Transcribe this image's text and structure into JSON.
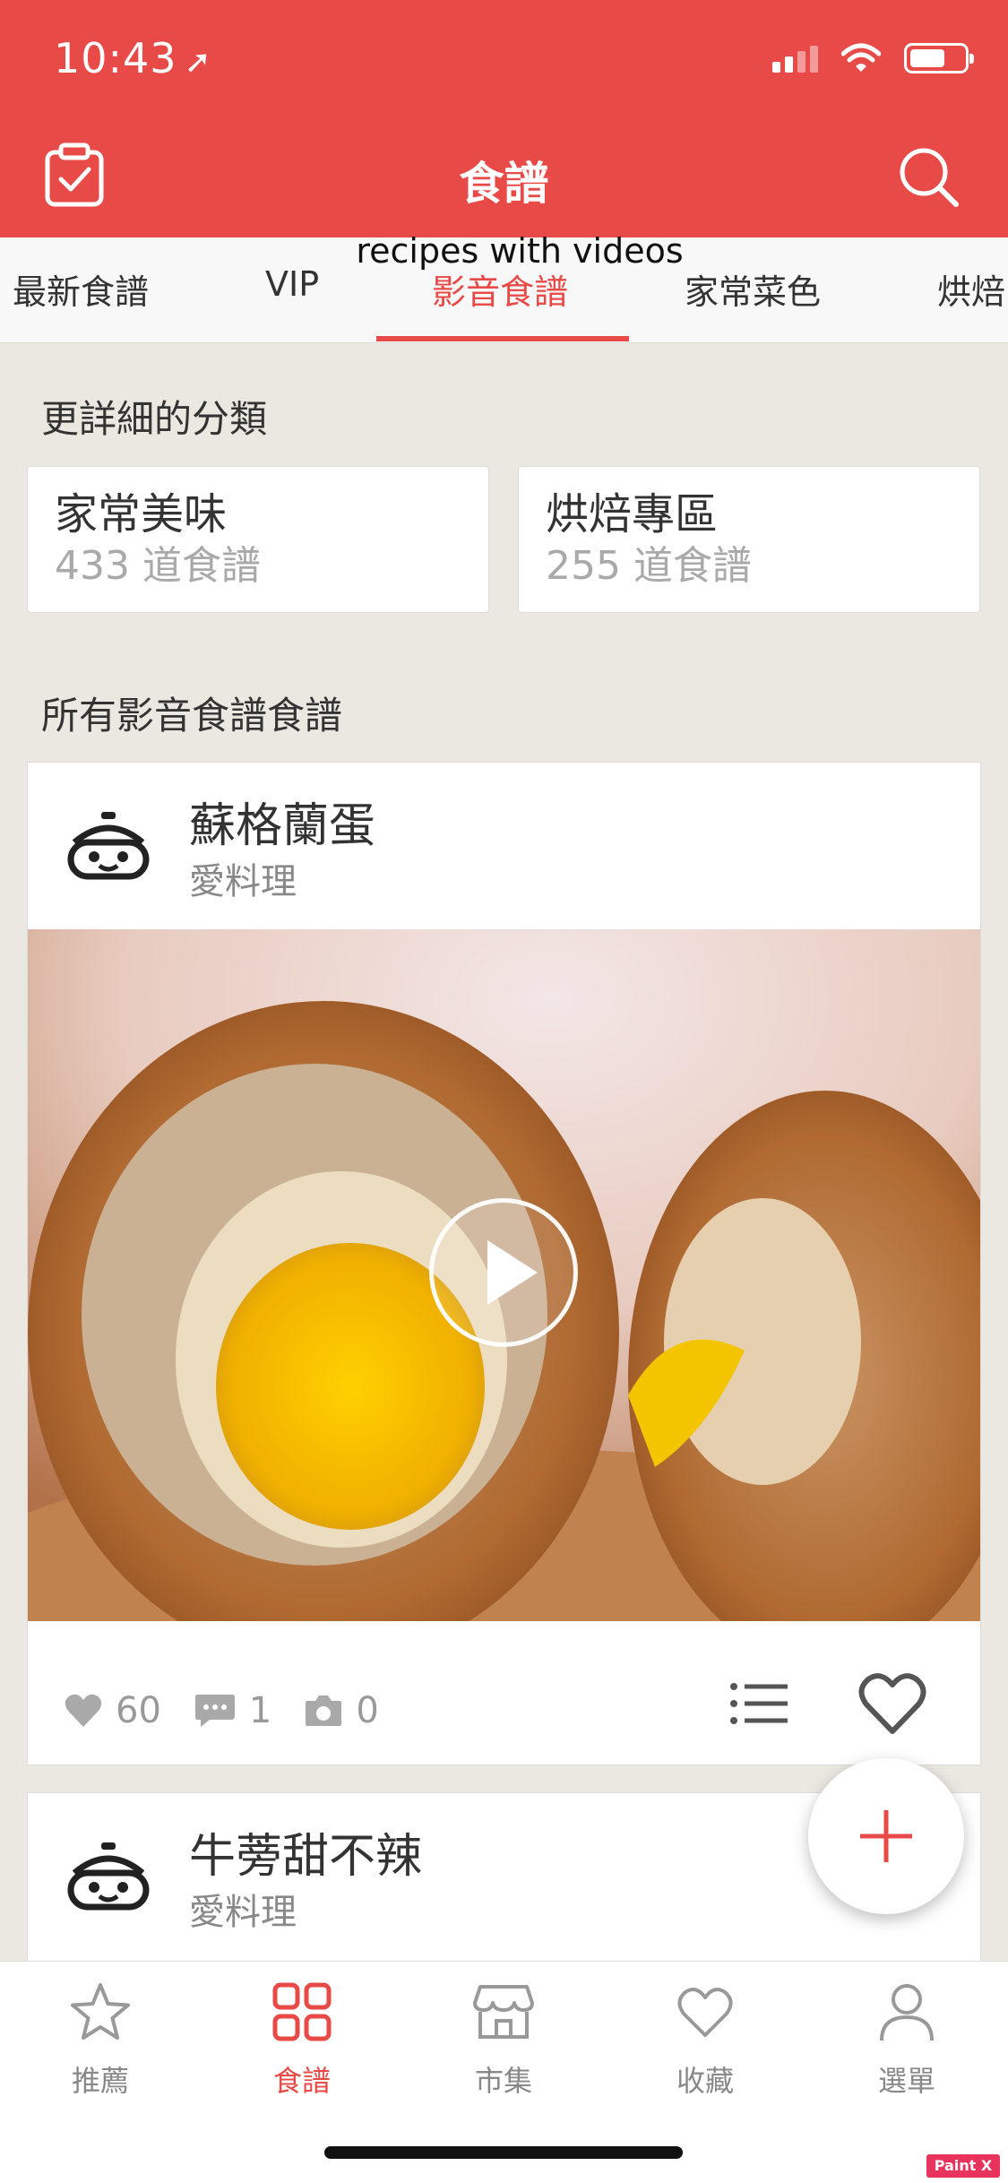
{
  "status_bar": {
    "time": "10:43",
    "location_arrow": "location-arrow-icon"
  },
  "nav": {
    "title": "食譜",
    "left_icon": "clipboard-check-icon",
    "right_icon": "search-icon"
  },
  "tabs": [
    {
      "label": "最新食譜",
      "active": false
    },
    {
      "label": "VIP",
      "active": false
    },
    {
      "label": "影音食譜",
      "active": true
    },
    {
      "label": "家常菜色",
      "active": false
    },
    {
      "label": "烘焙",
      "active": false
    }
  ],
  "annotation": "recipes with videos",
  "categories_section": {
    "title": "更詳細的分類",
    "items": [
      {
        "name": "家常美味",
        "count": "433 道食譜"
      },
      {
        "name": "烘焙專區",
        "count": "255 道食譜"
      }
    ]
  },
  "all_section": {
    "title": "所有影音食譜食譜"
  },
  "recipes": [
    {
      "title": "蘇格蘭蛋",
      "author": "愛料理",
      "likes": "60",
      "comments": "1",
      "photos": "0"
    },
    {
      "title": "牛蒡甜不辣",
      "author": "愛料理"
    }
  ],
  "bottom_nav": [
    {
      "label": "推薦",
      "icon": "star-icon",
      "active": false
    },
    {
      "label": "食譜",
      "icon": "grid-icon",
      "active": true
    },
    {
      "label": "市集",
      "icon": "store-icon",
      "active": false
    },
    {
      "label": "收藏",
      "icon": "heart-icon",
      "active": false
    },
    {
      "label": "選單",
      "icon": "user-icon",
      "active": false
    }
  ],
  "watermark": "Paint X lite",
  "colors": {
    "primary": "#e84a47",
    "background": "#ebe8e1",
    "muted": "#999999"
  }
}
